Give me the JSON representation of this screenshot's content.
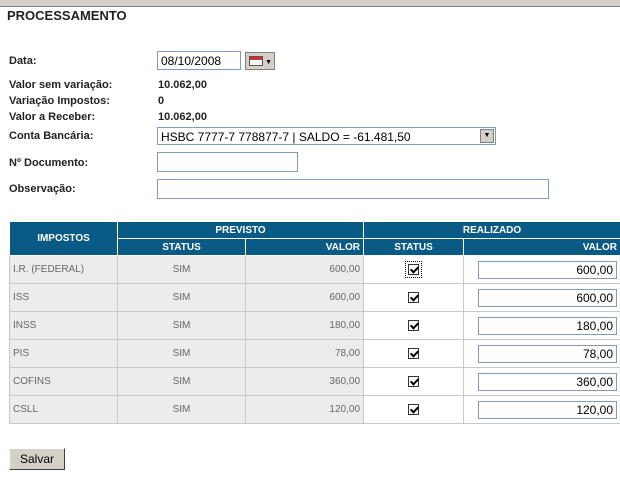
{
  "page": {
    "title": "PROCESSAMENTO"
  },
  "form": {
    "data_label": "Data:",
    "data_value": "08/10/2008",
    "valor_sem_variacao_label": "Valor sem variação:",
    "valor_sem_variacao": "10.062,00",
    "variacao_impostos_label": "Variação Impostos:",
    "variacao_impostos": "0",
    "valor_a_receber_label": "Valor a Receber:",
    "valor_a_receber": "10.062,00",
    "conta_bancaria_label": "Conta Bancária:",
    "conta_bancaria_value": "HSBC 7777-7 778877-7 | SALDO = -61.481,50",
    "documento_label": "Nº Documento:",
    "documento_value": "",
    "observacao_label": "Observação:",
    "observacao_value": ""
  },
  "table": {
    "impostos_header": "IMPOSTOS",
    "previsto_header": "PREVISTO",
    "realizado_header": "REALIZADO",
    "status_header": "STATUS",
    "valor_header": "VALOR",
    "rows": [
      {
        "name": "I.R. (FEDERAL)",
        "status": "SIM",
        "valor": "600,00",
        "realizado_checked": true,
        "realizado_valor": "600,00"
      },
      {
        "name": "ISS",
        "status": "SIM",
        "valor": "600,00",
        "realizado_checked": true,
        "realizado_valor": "600,00"
      },
      {
        "name": "INSS",
        "status": "SIM",
        "valor": "180,00",
        "realizado_checked": true,
        "realizado_valor": "180,00"
      },
      {
        "name": "PIS",
        "status": "SIM",
        "valor": "78,00",
        "realizado_checked": true,
        "realizado_valor": "78,00"
      },
      {
        "name": "COFINS",
        "status": "SIM",
        "valor": "360,00",
        "realizado_checked": true,
        "realizado_valor": "360,00"
      },
      {
        "name": "CSLL",
        "status": "SIM",
        "valor": "120,00",
        "realizado_checked": true,
        "realizado_valor": "120,00"
      }
    ]
  },
  "actions": {
    "salvar_label": "Salvar"
  },
  "icons": {
    "calendar": "calendar-icon",
    "dropdown": "chevron-down-icon",
    "check": "checkmark-icon"
  },
  "colors": {
    "header_bg": "#0a5a86",
    "row_bg": "#ececec",
    "input_border": "#7f9db9"
  }
}
